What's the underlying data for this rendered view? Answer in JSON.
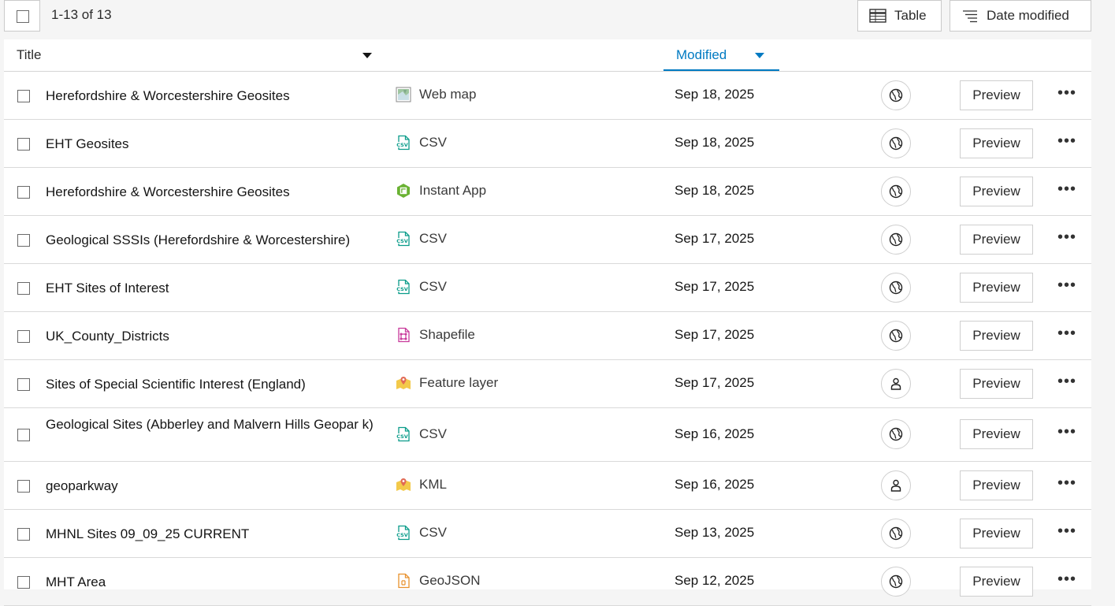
{
  "toolbar": {
    "count_text": "1-13 of 13",
    "view_label": "Table",
    "sort_label": "Date modified"
  },
  "header": {
    "title_label": "Title",
    "modified_label": "Modified"
  },
  "accent_color": "#007ac2",
  "rows": [
    {
      "title": "Herefordshire & Worcestershire Geosites",
      "type": "Web map",
      "type_icon": "webmap-icon",
      "date": "Sep 18, 2025",
      "sharing": "public-globe-icon",
      "preview": "Preview"
    },
    {
      "title": "EHT Geosites",
      "type": "CSV",
      "type_icon": "csv-icon",
      "date": "Sep 18, 2025",
      "sharing": "public-globe-icon",
      "preview": "Preview"
    },
    {
      "title": "Herefordshire & Worcestershire Geosites",
      "type": "Instant App",
      "type_icon": "instant-app-icon",
      "date": "Sep 18, 2025",
      "sharing": "public-globe-icon",
      "preview": "Preview"
    },
    {
      "title": "Geological SSSIs (Herefordshire & Worcestershire)",
      "type": "CSV",
      "type_icon": "csv-icon",
      "date": "Sep 17, 2025",
      "sharing": "public-globe-icon",
      "preview": "Preview"
    },
    {
      "title": "EHT Sites of Interest",
      "type": "CSV",
      "type_icon": "csv-icon",
      "date": "Sep 17, 2025",
      "sharing": "public-globe-icon",
      "preview": "Preview"
    },
    {
      "title": "UK_County_Districts",
      "type": "Shapefile",
      "type_icon": "shapefile-icon",
      "date": "Sep 17, 2025",
      "sharing": "public-globe-icon",
      "preview": "Preview"
    },
    {
      "title": "Sites of Special Scientific Interest (England)",
      "type": "Feature layer",
      "type_icon": "feature-layer-icon",
      "date": "Sep 17, 2025",
      "sharing": "owner-person-icon",
      "preview": "Preview"
    },
    {
      "title": "Geological Sites (Abberley and Malvern Hills Geopar k)",
      "type": "CSV",
      "type_icon": "csv-icon",
      "date": "Sep 16, 2025",
      "sharing": "public-globe-icon",
      "preview": "Preview"
    },
    {
      "title": "geoparkway",
      "type": "KML",
      "type_icon": "kml-icon",
      "date": "Sep 16, 2025",
      "sharing": "owner-person-icon",
      "preview": "Preview"
    },
    {
      "title": "MHNL Sites 09_09_25 CURRENT",
      "type": "CSV",
      "type_icon": "csv-icon",
      "date": "Sep 13, 2025",
      "sharing": "public-globe-icon",
      "preview": "Preview"
    },
    {
      "title": "MHT Area",
      "type": "GeoJSON",
      "type_icon": "geojson-icon",
      "date": "Sep 12, 2025",
      "sharing": "public-globe-icon",
      "preview": "Preview"
    }
  ]
}
